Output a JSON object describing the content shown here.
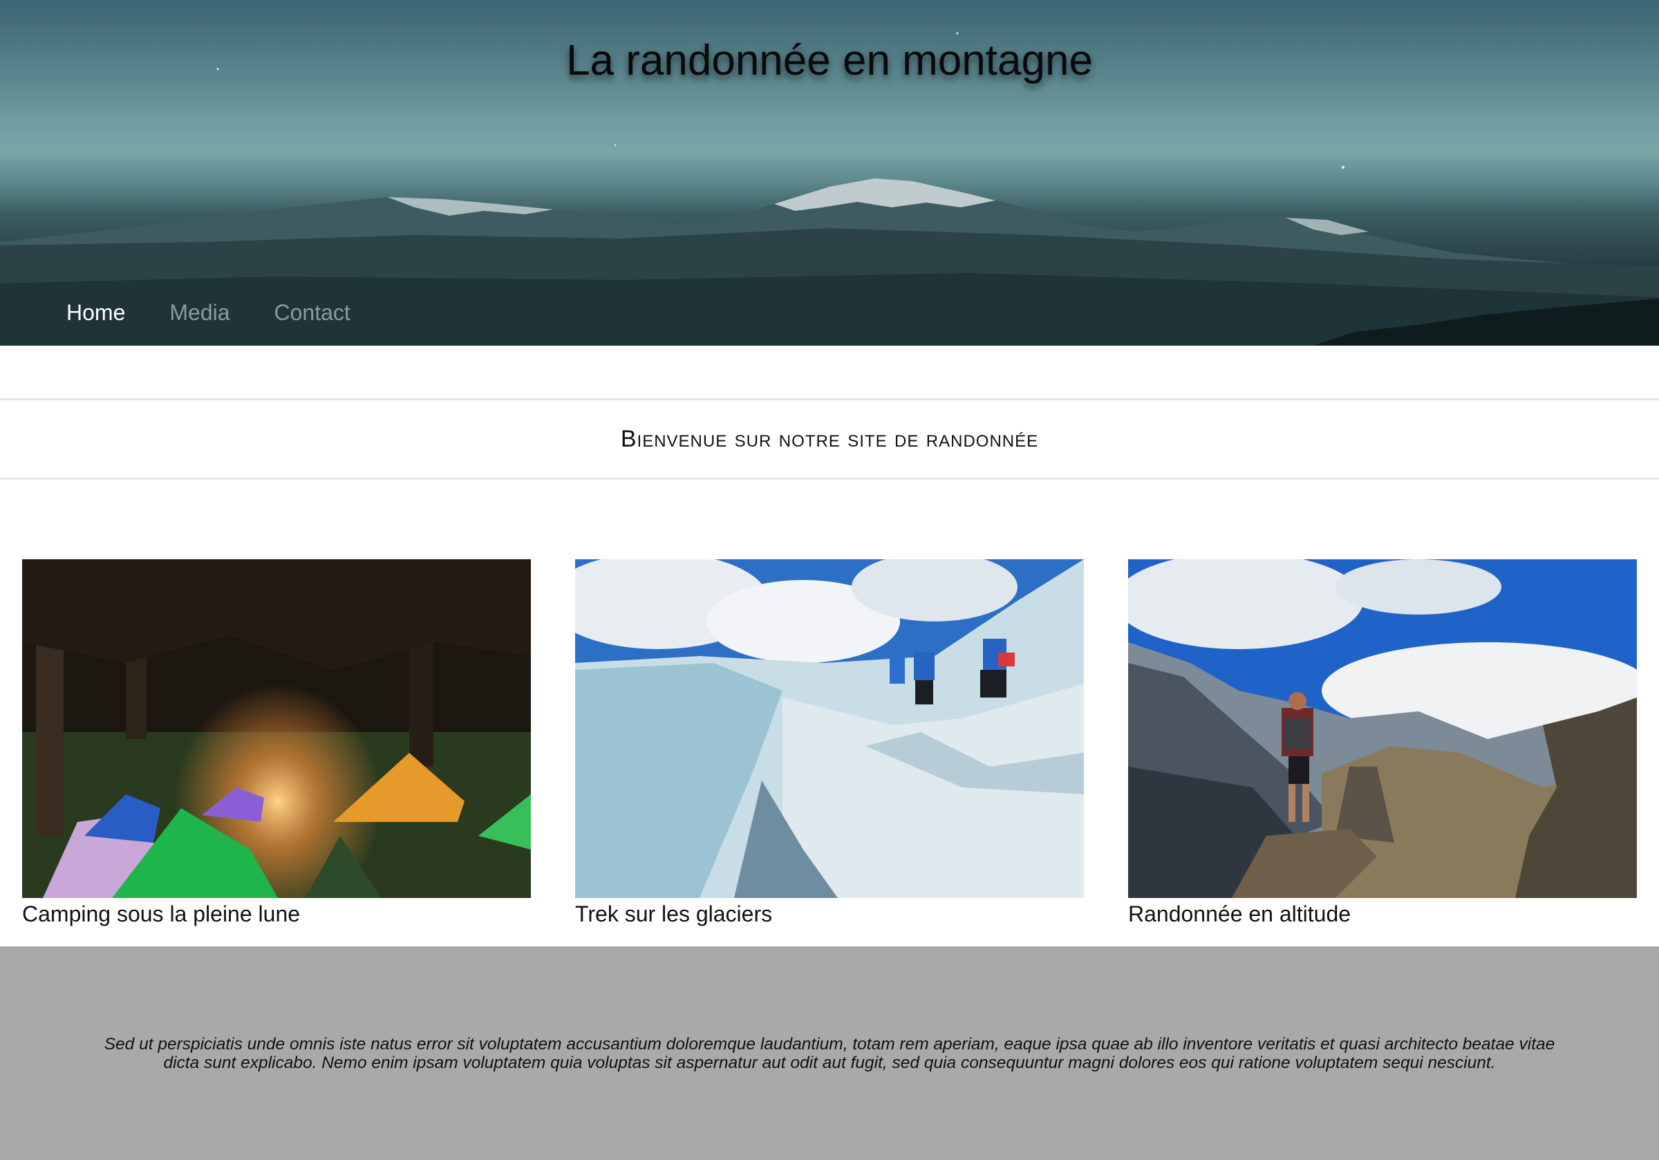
{
  "header": {
    "title": "La randonnée en montagne",
    "nav": [
      {
        "label": "Home",
        "active": true
      },
      {
        "label": "Media",
        "active": false
      },
      {
        "label": "Contact",
        "active": false
      }
    ]
  },
  "welcome": {
    "heading": "Bienvenue sur notre site de randonnée"
  },
  "cards": [
    {
      "caption": "Camping sous la pleine lune",
      "image": "camping-tents-at-night-image"
    },
    {
      "caption": "Trek sur les glaciers",
      "image": "glacier-trek-image"
    },
    {
      "caption": "Randonnée en altitude",
      "image": "high-altitude-hiker-image"
    }
  ],
  "footer": {
    "text": "Sed ut perspiciatis unde omnis iste natus error sit voluptatem accusantium doloremque laudantium, totam rem aperiam, eaque ipsa quae ab illo inventore veritatis et quasi architecto beatae vitae dicta sunt explicabo. Nemo enim ipsam voluptatem quia voluptas sit aspernatur aut odit aut fugit, sed quia consequuntur magni dolores eos qui ratione voluptatem sequi nesciunt."
  },
  "colors": {
    "footer_bg": "#a9a9a9",
    "nav_active": "#ffffff",
    "nav_inactive": "#8e9a9c"
  }
}
